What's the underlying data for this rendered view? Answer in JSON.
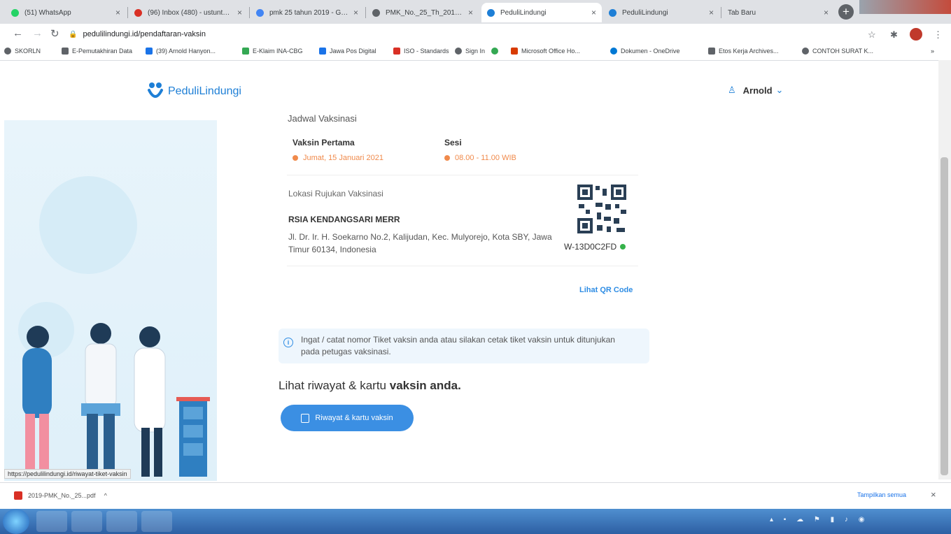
{
  "browser": {
    "tabs": [
      {
        "label": "(51) WhatsApp",
        "color": "#25d366"
      },
      {
        "label": "(96) Inbox (480) - ustuntalud...",
        "color": "#d93025"
      },
      {
        "label": "pmk 25 tahun 2019 - Go...",
        "color": "#4285f4"
      },
      {
        "label": "PMK_No._25_Th_2019_tt...",
        "color": "#5f6368"
      },
      {
        "label": "PeduliLindungi",
        "color": "#1e7fd6",
        "active": true
      },
      {
        "label": "PeduliLindungi",
        "color": "#1e7fd6"
      },
      {
        "label": "Tab Baru",
        "color": "#ffffff"
      }
    ],
    "url": "pedulilindungi.id/pendaftaran-vaksin",
    "bookmarks": [
      {
        "label": "SKORLN",
        "color": "#5f6368"
      },
      {
        "label": "E-Pemutakhiran Data",
        "color": "#5f6368"
      },
      {
        "label": "(39) Arnold Hanyon...",
        "color": "#1a73e8"
      },
      {
        "label": "E-Klaim INA-CBG",
        "color": "#34a853"
      },
      {
        "label": "Jawa Pos Digital",
        "color": "#1a73e8"
      },
      {
        "label": "ISO - Standards",
        "color": "#d93025"
      },
      {
        "label": "Sign In",
        "color": "#5f6368"
      },
      {
        "label": "",
        "color": "#34a853"
      },
      {
        "label": "Microsoft Office Ho...",
        "color": "#d83b01"
      },
      {
        "label": "Dokumen - OneDrive",
        "color": "#0078d4"
      },
      {
        "label": "Etos Kerja Archives...",
        "color": "#5f6368"
      },
      {
        "label": "CONTOH SURAT K...",
        "color": "#5f6368"
      }
    ],
    "bookmarks_more": "»"
  },
  "header": {
    "logo_text": "PeduliLindungi",
    "user_name": "Arnold"
  },
  "card": {
    "section_title": "Jadwal Vaksinasi",
    "dose_label": "Vaksin Pertama",
    "dose_date": "Jumat, 15 Januari 2021",
    "session_label": "Sesi",
    "session_time": "08.00 - 11.00 WIB",
    "location_label": "Lokasi Rujukan Vaksinasi",
    "location_name": "RSIA KENDANGSARI MERR",
    "location_address": "Jl. Dr. Ir. H. Soekarno No.2, Kalijudan, Kec. Mulyorejo, Kota SBY, Jawa Timur 60134, Indonesia",
    "ticket_code": "W-13D0C2FD",
    "qr_link": "Lihat QR Code"
  },
  "info_banner": "Ingat / catat nomor Tiket vaksin anda atau silakan cetak tiket vaksin untuk ditunjukan pada petugas vaksinasi.",
  "history": {
    "heading_prefix": "Lihat riwayat & kartu ",
    "heading_bold": "vaksin anda.",
    "button_label": "Riwayat & kartu vaksin"
  },
  "status_url": "https://pedulilindungi.id/riwayat-tiket-vaksin",
  "downloads": {
    "file": "2019-PMK_No._25...pdf",
    "show_all": "Tampilkan semua"
  },
  "colors": {
    "brand_blue": "#1e7fd6",
    "button_blue": "#3b8fe3",
    "accent_orange": "#f08a4b",
    "ticket_green": "#35b24a"
  }
}
